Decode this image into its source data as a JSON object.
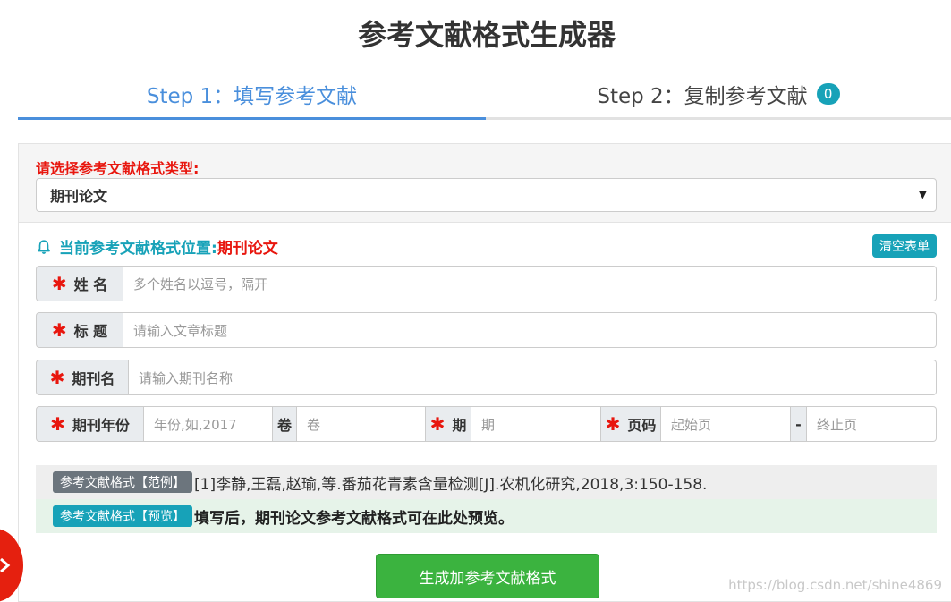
{
  "title": "参考文献格式生成器",
  "steps": [
    {
      "label": "Step 1：填写参考文献"
    },
    {
      "label": "Step 2：复制参考文献",
      "badge": "0"
    }
  ],
  "type_section": {
    "label": "请选择参考文献格式类型:",
    "selected": "期刊论文"
  },
  "location": {
    "label": "当前参考文献格式位置:",
    "value": "期刊论文"
  },
  "clear_button": "清空表单",
  "fields": {
    "name": {
      "label": "姓 名",
      "placeholder": "多个姓名以逗号，隔开"
    },
    "title": {
      "label": "标 题",
      "placeholder": "请输入文章标题"
    },
    "journal": {
      "label": "期刊名",
      "placeholder": "请输入期刊名称"
    },
    "year": {
      "label": "期刊年份",
      "placeholder": "年份,如,2017"
    },
    "volume": {
      "label": "卷",
      "placeholder": "卷"
    },
    "issue": {
      "label": "期",
      "placeholder": "期"
    },
    "pages": {
      "label": "页码",
      "start_placeholder": "起始页",
      "separator": "-",
      "end_placeholder": "终止页"
    }
  },
  "example": {
    "tag": "参考文献格式【范例】",
    "text": "[1]李静,王磊,赵瑜,等.番茄花青素含量检测[J].农机化研究,2018,3:150-158."
  },
  "preview": {
    "tag": "参考文献格式【预览】",
    "text": "填写后，期刊论文参考文献格式可在此处预览。"
  },
  "generate_button": "生成加参考文献格式",
  "watermark": "https://blog.csdn.net/shine4869",
  "colors": {
    "accent": "#4a8fdc",
    "teal": "#17a2b8",
    "red": "#e8160e",
    "green": "#3bb33f"
  }
}
